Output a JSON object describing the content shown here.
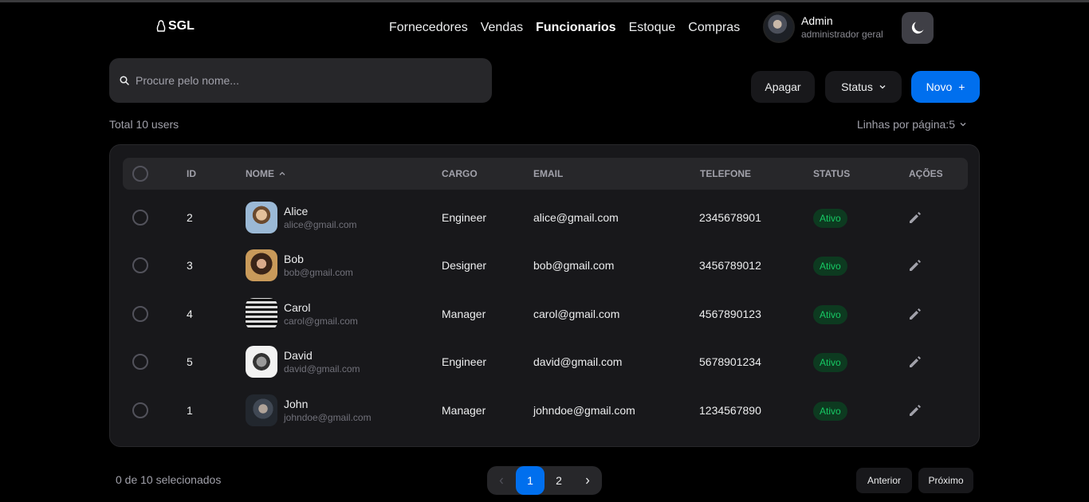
{
  "brand": {
    "name": "SGL",
    "icon": "penguin-icon"
  },
  "nav": [
    {
      "label": "Fornecedores",
      "active": false
    },
    {
      "label": "Vendas",
      "active": false
    },
    {
      "label": "Funcionarios",
      "active": true
    },
    {
      "label": "Estoque",
      "active": false
    },
    {
      "label": "Compras",
      "active": false
    }
  ],
  "user": {
    "name": "Admin",
    "role": "administrador geral"
  },
  "theme_toggle": {
    "icon": "moon-icon"
  },
  "search": {
    "placeholder": "Procure pelo nome...",
    "value": ""
  },
  "toolbar": {
    "delete_label": "Apagar",
    "status_label": "Status",
    "new_label": "Novo",
    "new_icon": "+"
  },
  "summary": {
    "total": "Total 10 users",
    "rows_per_page": "Linhas por página:5"
  },
  "table": {
    "headers": {
      "id": "ID",
      "name": "NOME",
      "role": "CARGO",
      "email": "EMAIL",
      "phone": "TELEFONE",
      "status": "STATUS",
      "actions": "AÇÕES"
    },
    "rows": [
      {
        "id": "2",
        "name": "Alice",
        "email": "alice@gmail.com",
        "role": "Engineer",
        "phone": "2345678901",
        "status": "Ativo"
      },
      {
        "id": "3",
        "name": "Bob",
        "email": "bob@gmail.com",
        "role": "Designer",
        "phone": "3456789012",
        "status": "Ativo"
      },
      {
        "id": "4",
        "name": "Carol",
        "email": "carol@gmail.com",
        "role": "Manager",
        "phone": "4567890123",
        "status": "Ativo"
      },
      {
        "id": "5",
        "name": "David",
        "email": "david@gmail.com",
        "role": "Engineer",
        "phone": "5678901234",
        "status": "Ativo"
      },
      {
        "id": "1",
        "name": "John",
        "email": "johndoe@gmail.com",
        "role": "Manager",
        "phone": "1234567890",
        "status": "Ativo"
      }
    ]
  },
  "footer": {
    "selected": "0 de 10 selecionados",
    "pages": [
      "1",
      "2"
    ],
    "current_page": "1",
    "prev_label": "Anterior",
    "next_label": "Próximo"
  },
  "colors": {
    "accent": "#006FEE",
    "success": "#17c964",
    "success_bg": "#0d3a20",
    "surface": "#18181b"
  }
}
